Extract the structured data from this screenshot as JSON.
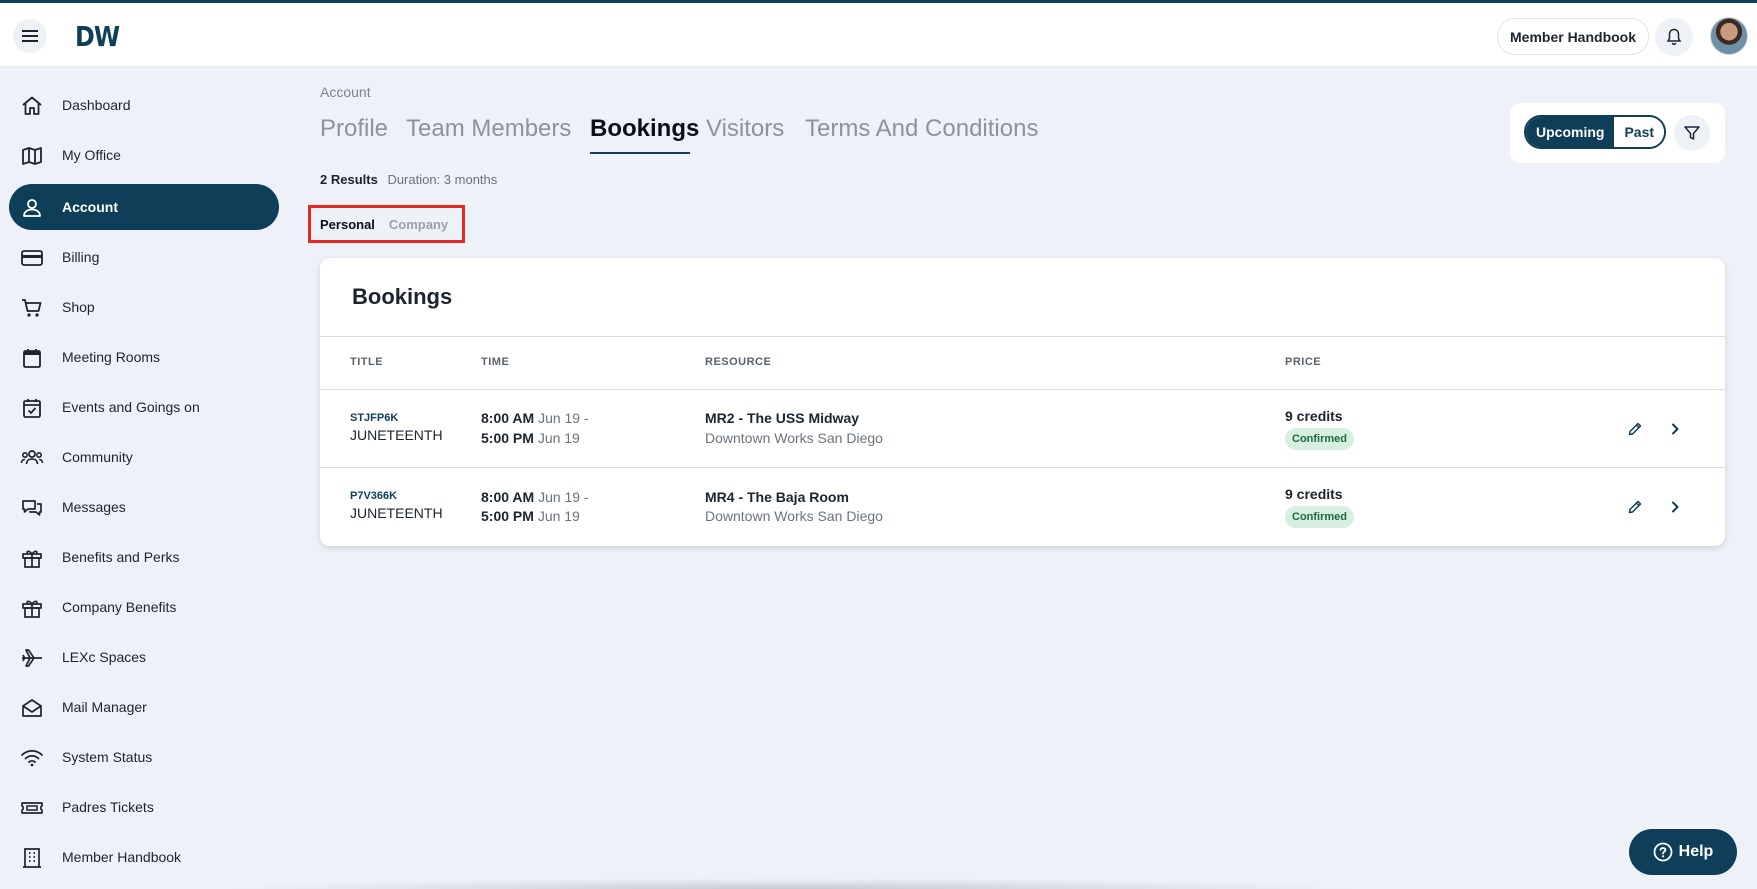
{
  "app": {
    "logo": "DW"
  },
  "header": {
    "handbook_button": "Member Handbook"
  },
  "sidebar": {
    "items": [
      {
        "label": "Dashboard",
        "icon": "home-icon"
      },
      {
        "label": "My Office",
        "icon": "map-icon"
      },
      {
        "label": "Account",
        "icon": "user-icon",
        "active": true
      },
      {
        "label": "Billing",
        "icon": "credit-card-icon"
      },
      {
        "label": "Shop",
        "icon": "cart-icon"
      },
      {
        "label": "Meeting Rooms",
        "icon": "calendar-icon"
      },
      {
        "label": "Events and Goings on",
        "icon": "calendar-check-icon"
      },
      {
        "label": "Community",
        "icon": "users-icon"
      },
      {
        "label": "Messages",
        "icon": "chat-icon"
      },
      {
        "label": "Benefits and Perks",
        "icon": "gift-icon"
      },
      {
        "label": "Company Benefits",
        "icon": "gift-icon"
      },
      {
        "label": "LEXc Spaces",
        "icon": "plane-icon"
      },
      {
        "label": "Mail Manager",
        "icon": "mail-open-icon"
      },
      {
        "label": "System Status",
        "icon": "wifi-icon"
      },
      {
        "label": "Padres Tickets",
        "icon": "ticket-icon"
      },
      {
        "label": "Member Handbook",
        "icon": "building-icon"
      }
    ]
  },
  "main": {
    "breadcrumb": "Account",
    "tabs": [
      {
        "label": "Profile"
      },
      {
        "label": "Team Members"
      },
      {
        "label": "Bookings",
        "active": true
      },
      {
        "label": "Visitors"
      },
      {
        "label": "Terms And Conditions"
      }
    ],
    "results_count": "2 Results",
    "duration": "Duration: 3 months",
    "subtabs": {
      "personal": "Personal",
      "company": "Company",
      "selected": "Personal"
    },
    "filter": {
      "upcoming": "Upcoming",
      "past": "Past",
      "selected": "Upcoming"
    }
  },
  "bookings": {
    "title": "Bookings",
    "columns": {
      "title": "TITLE",
      "time": "TIME",
      "resource": "RESOURCE",
      "price": "PRICE"
    },
    "rows": [
      {
        "code": "STJFP6K",
        "title": "JUNETEENTH",
        "start_time": "8:00 AM",
        "start_date": "Jun 19 -",
        "end_time": "5:00 PM",
        "end_date": "Jun 19",
        "resource": "MR2 - The USS Midway",
        "location": "Downtown Works San Diego",
        "price": "9 credits",
        "status": "Confirmed"
      },
      {
        "code": "P7V366K",
        "title": "JUNETEENTH",
        "start_time": "8:00 AM",
        "start_date": "Jun 19 -",
        "end_time": "5:00 PM",
        "end_date": "Jun 19",
        "resource": "MR4 - The Baja Room",
        "location": "Downtown Works San Diego",
        "price": "9 credits",
        "status": "Confirmed"
      }
    ]
  },
  "help": {
    "label": "Help"
  },
  "colors": {
    "brand": "#0e3e58",
    "highlight": "#e32a22",
    "badge_bg": "#d6efe1",
    "badge_text": "#1d6a3c"
  }
}
